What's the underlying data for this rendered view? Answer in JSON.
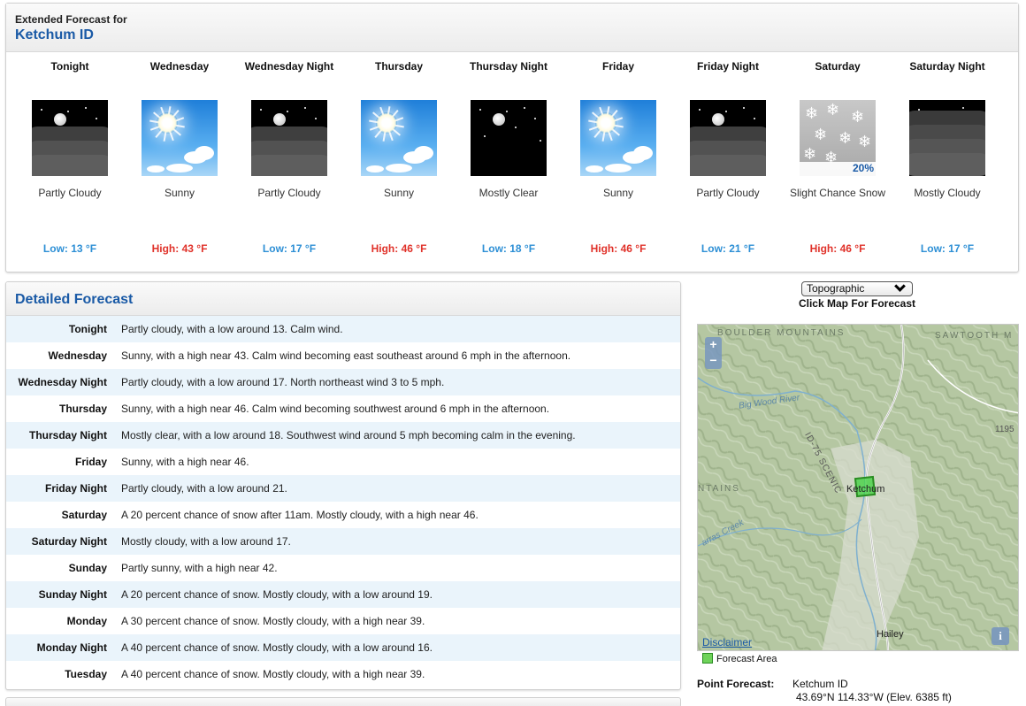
{
  "extended": {
    "prefix": "Extended Forecast for",
    "location": "Ketchum ID",
    "periods": [
      {
        "name": "Tonight",
        "icon": "partly-cloudy-night-icon",
        "desc": "Partly Cloudy",
        "temp": "Low: 13 °F",
        "kind": "low"
      },
      {
        "name": "Wednesday",
        "icon": "sunny-icon",
        "desc": "Sunny",
        "temp": "High: 43 °F",
        "kind": "high"
      },
      {
        "name": "Wednesday Night",
        "icon": "partly-cloudy-night-icon",
        "desc": "Partly Cloudy",
        "temp": "Low: 17 °F",
        "kind": "low"
      },
      {
        "name": "Thursday",
        "icon": "sunny-icon",
        "desc": "Sunny",
        "temp": "High: 46 °F",
        "kind": "high"
      },
      {
        "name": "Thursday Night",
        "icon": "mostly-clear-night-icon",
        "desc": "Mostly Clear",
        "temp": "Low: 18 °F",
        "kind": "low"
      },
      {
        "name": "Friday",
        "icon": "sunny-icon",
        "desc": "Sunny",
        "temp": "High: 46 °F",
        "kind": "high"
      },
      {
        "name": "Friday Night",
        "icon": "partly-cloudy-night-icon",
        "desc": "Partly Cloudy",
        "temp": "Low: 21 °F",
        "kind": "low"
      },
      {
        "name": "Saturday",
        "icon": "snow-icon",
        "desc": "Slight Chance Snow",
        "temp": "High: 46 °F",
        "kind": "high",
        "pop": "20%"
      },
      {
        "name": "Saturday Night",
        "icon": "mostly-cloudy-night-icon",
        "desc": "Mostly Cloudy",
        "temp": "Low: 17 °F",
        "kind": "low"
      }
    ]
  },
  "detailed": {
    "title": "Detailed Forecast",
    "rows": [
      {
        "label": "Tonight",
        "text": "Partly cloudy, with a low around 13. Calm wind."
      },
      {
        "label": "Wednesday",
        "text": "Sunny, with a high near 43. Calm wind becoming east southeast around 6 mph in the afternoon."
      },
      {
        "label": "Wednesday Night",
        "text": "Partly cloudy, with a low around 17. North northeast wind 3 to 5 mph."
      },
      {
        "label": "Thursday",
        "text": "Sunny, with a high near 46. Calm wind becoming southwest around 6 mph in the afternoon."
      },
      {
        "label": "Thursday Night",
        "text": "Mostly clear, with a low around 18. Southwest wind around 5 mph becoming calm in the evening."
      },
      {
        "label": "Friday",
        "text": "Sunny, with a high near 46."
      },
      {
        "label": "Friday Night",
        "text": "Partly cloudy, with a low around 21."
      },
      {
        "label": "Saturday",
        "text": "A 20 percent chance of snow after 11am. Mostly cloudy, with a high near 46."
      },
      {
        "label": "Saturday Night",
        "text": "Mostly cloudy, with a low around 17."
      },
      {
        "label": "Sunday",
        "text": "Partly sunny, with a high near 42."
      },
      {
        "label": "Sunday Night",
        "text": "A 20 percent chance of snow. Mostly cloudy, with a low around 19."
      },
      {
        "label": "Monday",
        "text": "A 30 percent chance of snow. Mostly cloudy, with a high near 39."
      },
      {
        "label": "Monday Night",
        "text": "A 40 percent chance of snow. Mostly cloudy, with a low around 16."
      },
      {
        "label": "Tuesday",
        "text": "A 40 percent chance of snow. Mostly cloudy, with a high near 39."
      }
    ]
  },
  "map": {
    "layer_select": "Topographic",
    "hint": "Click Map For Forecast",
    "zoom_in": "+",
    "zoom_out": "−",
    "labels": {
      "boulder": "BOULDER MOUNTAINS",
      "sawtooth": "SAWTOOTH M",
      "river": "Big Wood River",
      "scenic": "ID-75 SCENIC",
      "ntains": "NTAINS",
      "creek": "arras Creek",
      "num": "1195"
    },
    "cities": {
      "ketchum": "Ketchum",
      "hailey": "Hailey"
    },
    "disclaimer": "Disclaimer",
    "info": "i",
    "legend": "Forecast Area"
  },
  "point_forecast": {
    "label": "Point Forecast:",
    "place": "Ketchum ID",
    "coords": "43.69°N 114.33°W (Elev. 6385 ft)"
  },
  "colors": {
    "accent": "#1a5aa6",
    "low": "#2d8fd5",
    "high": "#e0322a",
    "row_alt": "#eaf4fb"
  }
}
